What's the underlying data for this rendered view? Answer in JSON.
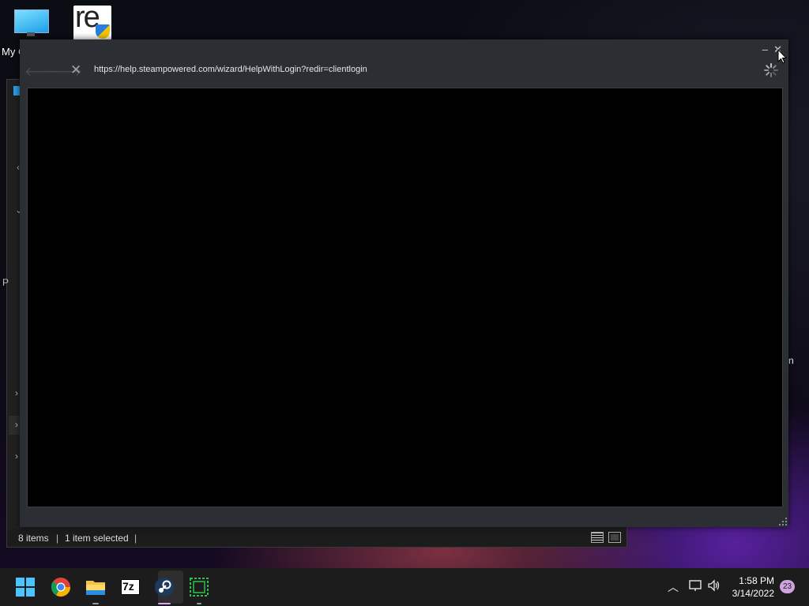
{
  "desktop": {
    "icons": [
      {
        "label": "My C",
        "icon": "computer-icon"
      },
      {
        "label": "",
        "icon": "re-app-icon",
        "text": "re"
      }
    ]
  },
  "explorer": {
    "items_count": "8 items",
    "selection": "1 item selected",
    "side_letter": "P",
    "right_letter": "n"
  },
  "steam_browser": {
    "url": "https://help.steampowered.com/wizard/HelpWithLogin?redir=clientlogin",
    "minimize_label": "–",
    "close_label": "✕",
    "stop_label": "✕",
    "back_label": "🡐",
    "forward_label": "🡒",
    "loading": true
  },
  "taskbar": {
    "apps": [
      "start-icon",
      "chrome-icon",
      "file-explorer-icon",
      "7zip-icon",
      "steam-icon",
      "terminal-icon"
    ],
    "sevenzip_label": "7z",
    "time": "1:58 PM",
    "date": "3/14/2022",
    "notification_count": "23"
  }
}
